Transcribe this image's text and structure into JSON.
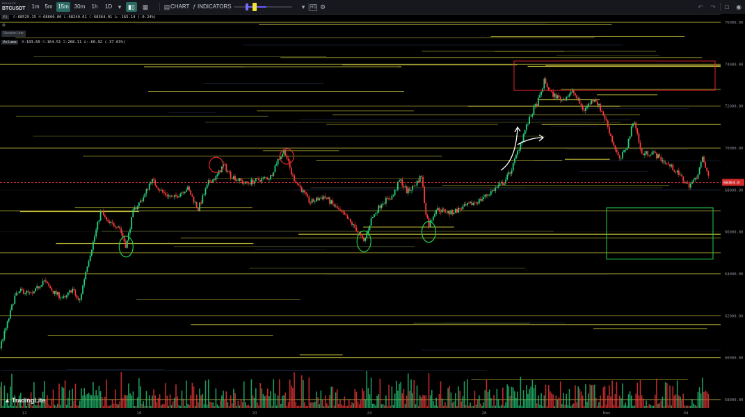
{
  "toolbar": {
    "exchange": "BINANCE",
    "symbol": "BTCUSDT",
    "timeframes": [
      {
        "label": "1m",
        "active": false
      },
      {
        "label": "5m",
        "active": false
      },
      {
        "label": "15m",
        "active": true
      },
      {
        "label": "30m",
        "active": false
      },
      {
        "label": "1h",
        "active": false
      },
      {
        "label": "1D",
        "active": false
      }
    ],
    "chart_label": "CHART",
    "indicators_label": "INDICATORS",
    "icons": [
      "chevron-down-icon",
      "candle-type-icon",
      "chart-icon",
      "fx-icon",
      "hd-badge-icon",
      "undo-icon",
      "redo-icon",
      "fullscreen-icon",
      "camera-icon"
    ]
  },
  "legend": {
    "price_panel_badge": "P1",
    "ohlc": {
      "o": "68529.15",
      "h": "68600.00",
      "l": "68240.61",
      "c": "68364.01",
      "change": "-165.14 (-0.24%)"
    },
    "session_line_label": "Session Line",
    "volume": {
      "label": "Volume",
      "b": "103.60",
      "s": "164.51",
      "sigma": "268.11",
      "delta": "-60.92 (-37.03%)"
    }
  },
  "price_axis": {
    "ticks": [
      "76000.00",
      "74000.00",
      "72000.00",
      "70000.00",
      "68000.00",
      "66000.00",
      "64000.00",
      "62000.00",
      "60000.00",
      "58000.00"
    ],
    "current_price_label": "68364.0"
  },
  "time_axis": {
    "ticks": [
      "12",
      "16",
      "20",
      "24",
      "28",
      "Nov",
      "04"
    ]
  },
  "chart_data": {
    "type": "candlestick",
    "y_range": [
      57600,
      76400
    ],
    "current_price": 68364,
    "price_path": [
      [
        0,
        60500
      ],
      [
        0.01,
        61600
      ],
      [
        0.02,
        62900
      ],
      [
        0.03,
        63200
      ],
      [
        0.045,
        63000
      ],
      [
        0.06,
        63700
      ],
      [
        0.075,
        63100
      ],
      [
        0.09,
        62800
      ],
      [
        0.1,
        63300
      ],
      [
        0.11,
        62600
      ],
      [
        0.12,
        64300
      ],
      [
        0.13,
        65600
      ],
      [
        0.14,
        67000
      ],
      [
        0.15,
        66400
      ],
      [
        0.165,
        66300
      ],
      [
        0.175,
        65300
      ],
      [
        0.185,
        67000
      ],
      [
        0.2,
        67700
      ],
      [
        0.21,
        68500
      ],
      [
        0.225,
        67900
      ],
      [
        0.24,
        67600
      ],
      [
        0.26,
        68100
      ],
      [
        0.275,
        67100
      ],
      [
        0.29,
        68400
      ],
      [
        0.3,
        68600
      ],
      [
        0.31,
        69200
      ],
      [
        0.32,
        68700
      ],
      [
        0.34,
        68300
      ],
      [
        0.36,
        68500
      ],
      [
        0.375,
        68600
      ],
      [
        0.385,
        69400
      ],
      [
        0.395,
        69900
      ],
      [
        0.405,
        68700
      ],
      [
        0.415,
        68200
      ],
      [
        0.43,
        67400
      ],
      [
        0.45,
        67700
      ],
      [
        0.465,
        67200
      ],
      [
        0.48,
        66700
      ],
      [
        0.495,
        66100
      ],
      [
        0.505,
        65500
      ],
      [
        0.515,
        66600
      ],
      [
        0.53,
        67400
      ],
      [
        0.545,
        67700
      ],
      [
        0.555,
        68500
      ],
      [
        0.565,
        67900
      ],
      [
        0.575,
        68200
      ],
      [
        0.585,
        68700
      ],
      [
        0.59,
        67100
      ],
      [
        0.595,
        66300
      ],
      [
        0.605,
        67100
      ],
      [
        0.625,
        66900
      ],
      [
        0.645,
        67200
      ],
      [
        0.665,
        67500
      ],
      [
        0.685,
        68000
      ],
      [
        0.7,
        68400
      ],
      [
        0.71,
        69000
      ],
      [
        0.72,
        70000
      ],
      [
        0.73,
        71000
      ],
      [
        0.74,
        71800
      ],
      [
        0.75,
        72500
      ],
      [
        0.755,
        73200
      ],
      [
        0.765,
        72600
      ],
      [
        0.78,
        72300
      ],
      [
        0.795,
        72700
      ],
      [
        0.81,
        71800
      ],
      [
        0.825,
        72400
      ],
      [
        0.84,
        71400
      ],
      [
        0.85,
        70300
      ],
      [
        0.86,
        69400
      ],
      [
        0.87,
        70100
      ],
      [
        0.88,
        71400
      ],
      [
        0.89,
        69700
      ],
      [
        0.905,
        69800
      ],
      [
        0.92,
        69400
      ],
      [
        0.935,
        69000
      ],
      [
        0.945,
        68600
      ],
      [
        0.955,
        68200
      ],
      [
        0.965,
        68500
      ],
      [
        0.975,
        69500
      ],
      [
        0.985,
        68400
      ]
    ],
    "annotations": {
      "red_box": {
        "price_top": 74150,
        "price_bottom": 72750
      },
      "green_box": {
        "price_top": 67150,
        "price_bottom": 64700
      },
      "red_circles": [
        {
          "x": 0.3,
          "price": 69200
        },
        {
          "x": 0.398,
          "price": 69600
        }
      ],
      "green_circles": [
        {
          "x": 0.175,
          "price": 65300
        },
        {
          "x": 0.505,
          "price": 65550
        },
        {
          "x": 0.595,
          "price": 66000
        }
      ]
    }
  },
  "colors": {
    "up": "#26d07c",
    "down": "#ff3b3b",
    "level_line": "#c8c23a",
    "current_price": "#ff4040",
    "grid": "#121318",
    "axis_text": "#8b9099"
  }
}
